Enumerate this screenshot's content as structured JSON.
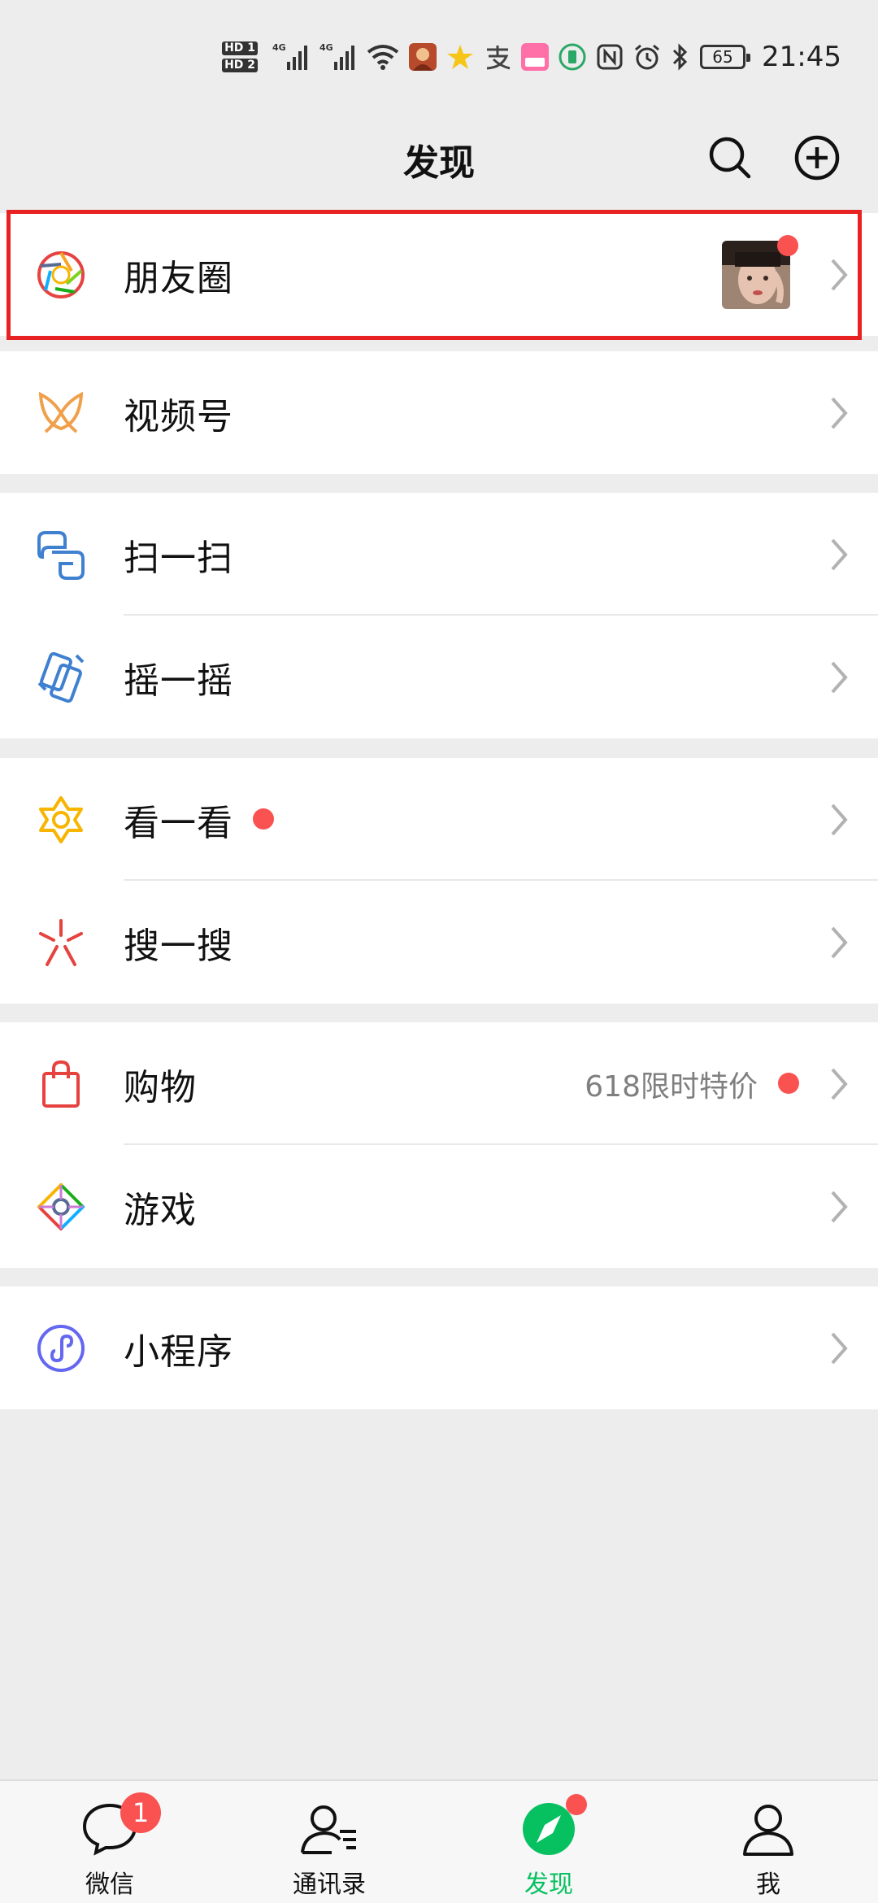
{
  "status_bar": {
    "hd1": "HD 1",
    "hd2": "HD 2",
    "net1": "4G",
    "net2": "4G",
    "battery": "65",
    "time": "21:45"
  },
  "header": {
    "title": "发现",
    "search_icon": "search-icon",
    "add_icon": "plus-circle-icon"
  },
  "sections": [
    {
      "items": [
        {
          "label": "朋友圈",
          "icon": "moments-shutter-icon",
          "has_dot": true,
          "has_thumbnail": true
        }
      ]
    },
    {
      "items": [
        {
          "label": "视频号",
          "icon": "channels-icon"
        }
      ]
    },
    {
      "items": [
        {
          "label": "扫一扫",
          "icon": "scan-icon"
        },
        {
          "label": "摇一摇",
          "icon": "shake-icon"
        }
      ]
    },
    {
      "items": [
        {
          "label": "看一看",
          "icon": "top-stories-icon",
          "has_dot": true
        },
        {
          "label": "搜一搜",
          "icon": "search-sparkle-icon"
        }
      ]
    },
    {
      "items": [
        {
          "label": "购物",
          "icon": "shopping-bag-icon",
          "subtext": "618限时特价",
          "has_dot": true
        },
        {
          "label": "游戏",
          "icon": "games-icon"
        }
      ]
    },
    {
      "items": [
        {
          "label": "小程序",
          "icon": "mini-programs-icon"
        }
      ]
    }
  ],
  "tabbar": {
    "tabs": [
      {
        "label": "微信",
        "icon": "chat-bubble-icon",
        "badge": "1"
      },
      {
        "label": "通讯录",
        "icon": "contacts-icon"
      },
      {
        "label": "发现",
        "icon": "compass-icon",
        "active": true,
        "has_dot": true
      },
      {
        "label": "我",
        "icon": "person-icon"
      }
    ]
  },
  "colors": {
    "accent_green": "#07c160",
    "badge_red": "#fa5151",
    "highlight_red": "#e82222",
    "background": "#ededed"
  }
}
